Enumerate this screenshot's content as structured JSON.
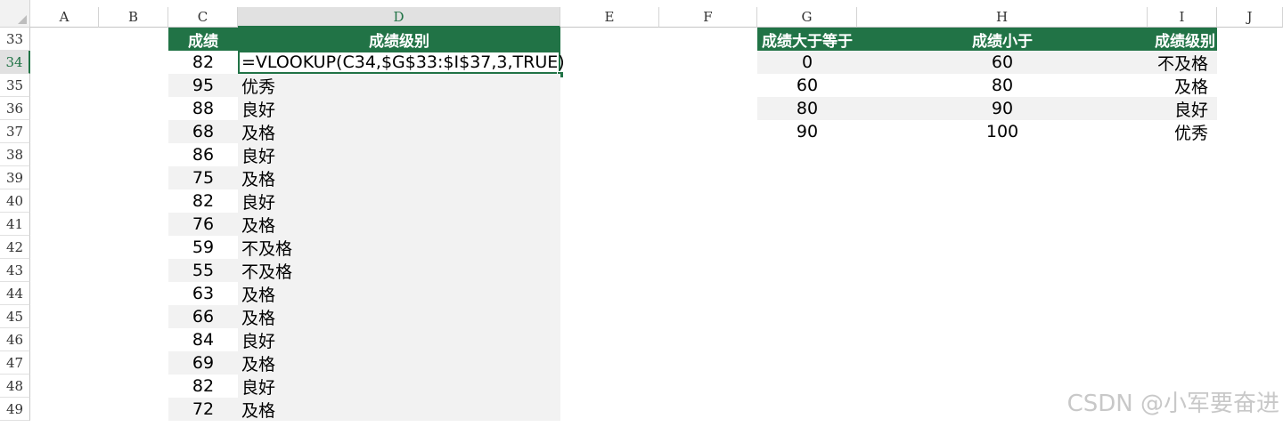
{
  "columns": [
    "A",
    "B",
    "C",
    "D",
    "E",
    "F",
    "G",
    "H",
    "I",
    "J"
  ],
  "rows": [
    "33",
    "34",
    "35",
    "36",
    "37",
    "38",
    "39",
    "40",
    "41",
    "42",
    "43",
    "44",
    "45",
    "46",
    "47",
    "48",
    "49"
  ],
  "score_table": {
    "header_score": "成绩",
    "header_grade": "成绩级别",
    "formula": "=VLOOKUP(C34,$G$33:$I$37,3,TRUE)",
    "scores": [
      "82",
      "95",
      "88",
      "68",
      "86",
      "75",
      "82",
      "76",
      "59",
      "55",
      "63",
      "66",
      "84",
      "69",
      "82",
      "72"
    ],
    "grades": [
      "",
      "优秀",
      "良好",
      "及格",
      "良好",
      "及格",
      "良好",
      "及格",
      "不及格",
      "不及格",
      "及格",
      "及格",
      "良好",
      "及格",
      "良好",
      "及格"
    ]
  },
  "lookup_table": {
    "headers": [
      "成绩大于等于",
      "成绩小于",
      "成绩级别"
    ],
    "rows": [
      [
        "0",
        "60",
        "不及格"
      ],
      [
        "60",
        "80",
        "及格"
      ],
      [
        "80",
        "90",
        "良好"
      ],
      [
        "90",
        "100",
        "优秀"
      ]
    ]
  },
  "colors": {
    "accent": "#217346",
    "shade": "#f2f2f2"
  },
  "watermark": "CSDN @小军要奋进"
}
